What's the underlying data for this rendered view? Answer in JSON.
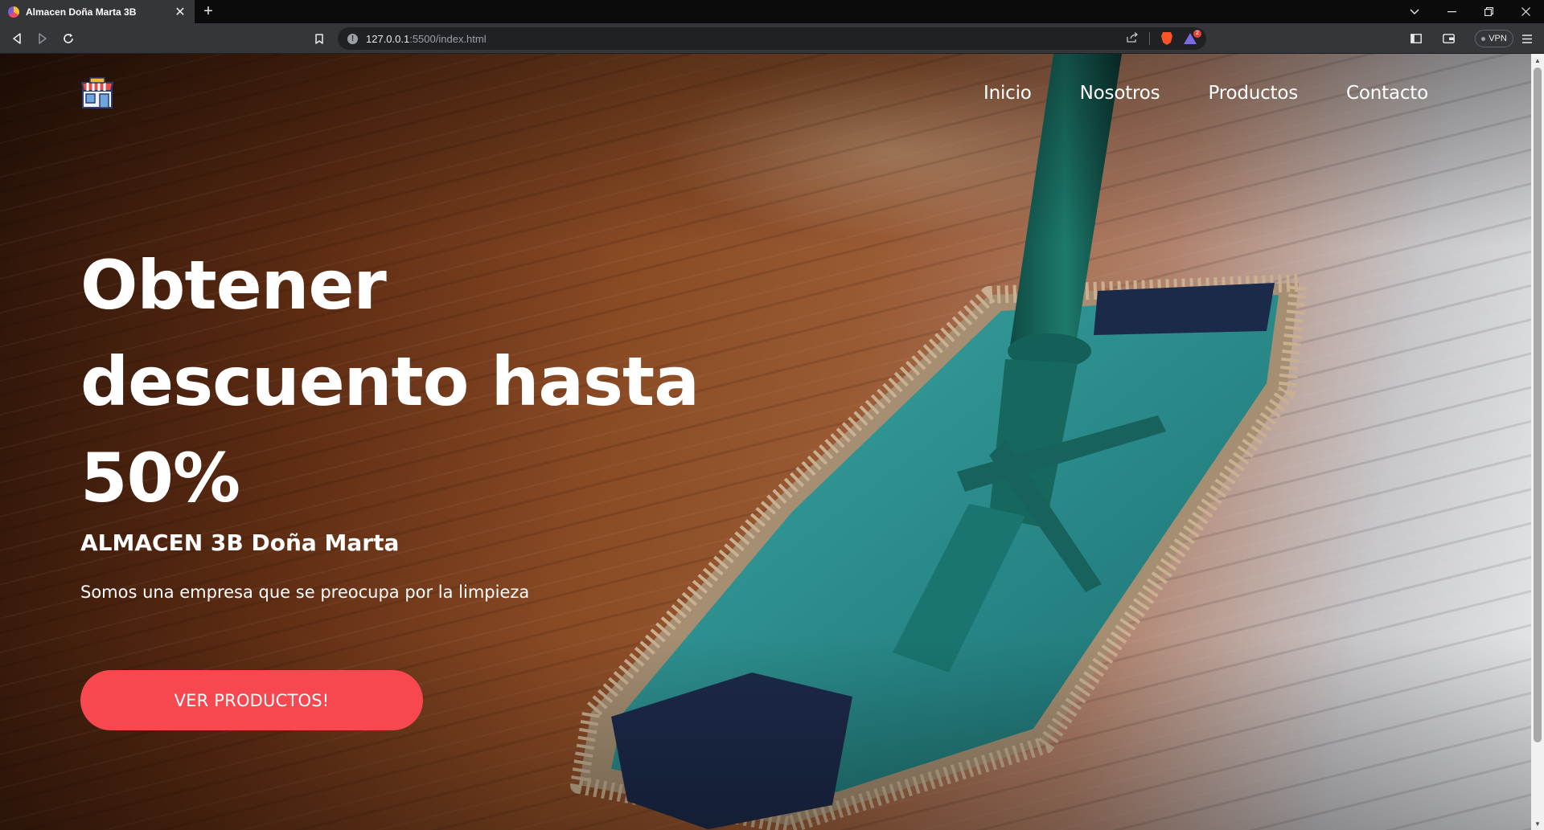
{
  "browser": {
    "tab_title": "Almacen Doña Marta 3B",
    "tab_close": "✕",
    "new_tab": "+",
    "url_host": "127.0.0.1",
    "url_path": ":5500/index.html",
    "vpn_label": "VPN",
    "rewards_count": "2",
    "icons": {
      "back": "back-icon",
      "forward": "forward-icon",
      "reload": "reload-icon",
      "bookmark": "bookmark-icon",
      "site-info": "info-icon",
      "share": "share-icon",
      "brave-shields": "brave-shields-icon",
      "rewards": "rewards-icon",
      "sidebar": "sidebar-icon",
      "wallet": "wallet-icon",
      "menu": "menu-icon"
    }
  },
  "nav": {
    "items": [
      "Inicio",
      "Nosotros",
      "Productos",
      "Contacto"
    ]
  },
  "hero": {
    "title": "Obtener descuento hasta 50%",
    "subtitle": "ALMACEN 3B Doña Marta",
    "text": "Somos una empresa que se preocupa por la limpieza",
    "cta_label": "VER PRODUCTOS!"
  },
  "colors": {
    "cta": "#f7474f",
    "text": "#ffffff",
    "chrome_bg": "#35363a"
  }
}
